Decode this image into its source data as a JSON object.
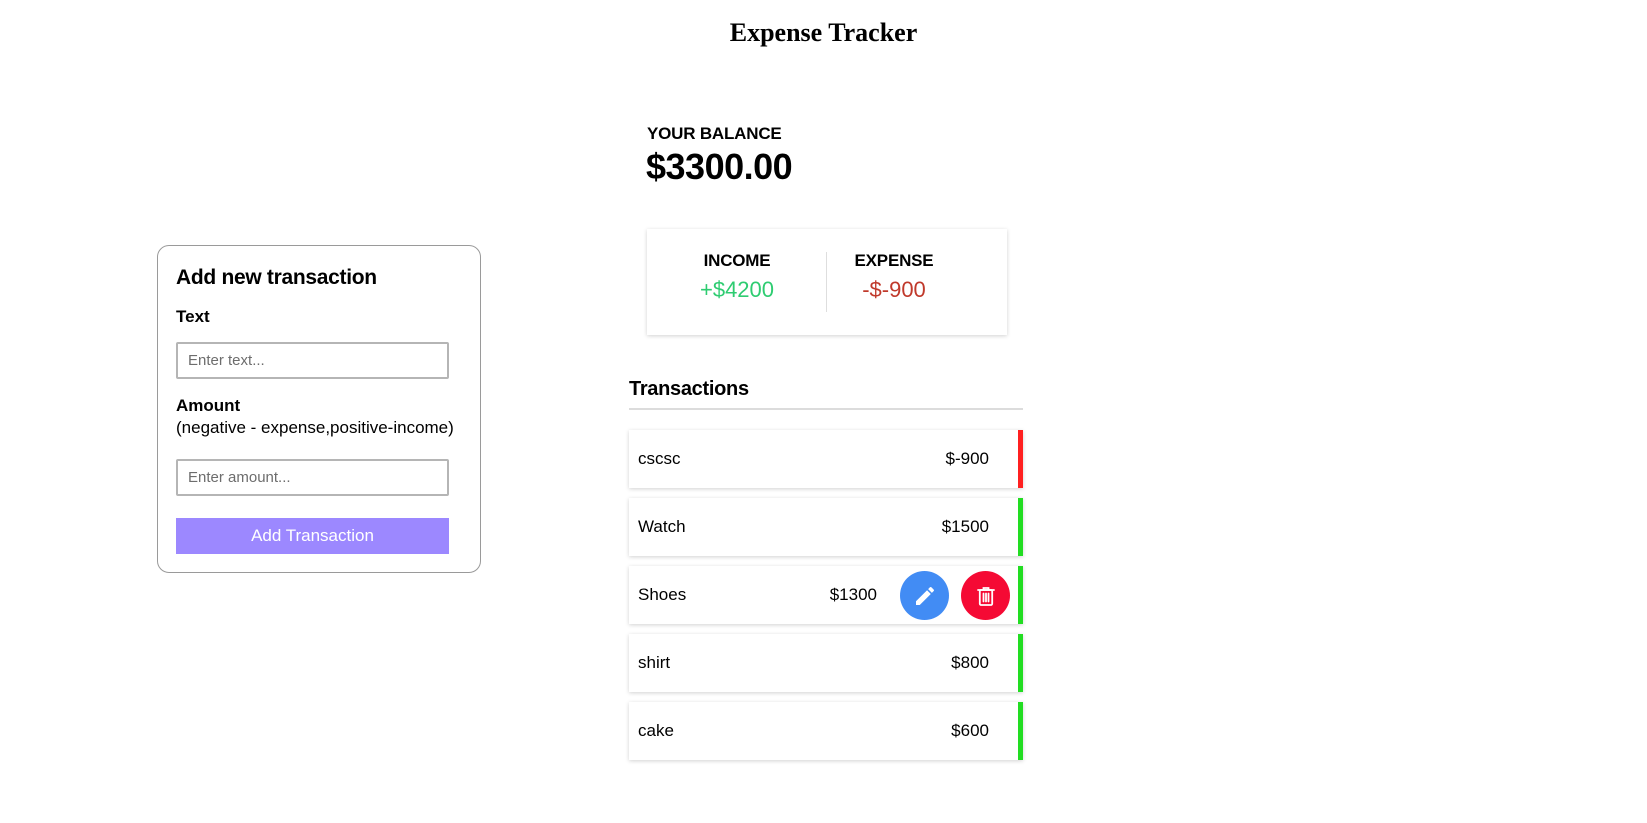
{
  "app": {
    "title": "Expense Tracker"
  },
  "add_form": {
    "title": "Add new transaction",
    "text_label": "Text",
    "text_placeholder": "Enter text...",
    "amount_label": "Amount",
    "amount_hint": "(negative - expense,positive-income)",
    "amount_placeholder": "Enter amount...",
    "submit_label": "Add Transaction"
  },
  "balance": {
    "label": "YOUR BALANCE",
    "amount": "$3300.00"
  },
  "summary": {
    "income_label": "INCOME",
    "income_value": "+$4200",
    "expense_label": "EXPENSE",
    "expense_value": "-$-900"
  },
  "transactions": {
    "title": "Transactions",
    "items": [
      {
        "name": "cscsc",
        "amount": "$-900",
        "type": "minus"
      },
      {
        "name": "Watch",
        "amount": "$1500",
        "type": "plus"
      },
      {
        "name": "Shoes",
        "amount": "$1300",
        "type": "plus",
        "hovered": true
      },
      {
        "name": "shirt",
        "amount": "$800",
        "type": "plus"
      },
      {
        "name": "cake",
        "amount": "$600",
        "type": "plus"
      }
    ]
  },
  "icons": {
    "edit": "pencil-icon",
    "delete": "trash-icon"
  },
  "colors": {
    "income": "#2ecc71",
    "expense": "#c0392b",
    "accent_button": "#9c88ff",
    "minus_border": "#ff2020",
    "plus_border": "#22dd22",
    "edit_button": "#428cf4",
    "delete_button": "#f50a34"
  }
}
